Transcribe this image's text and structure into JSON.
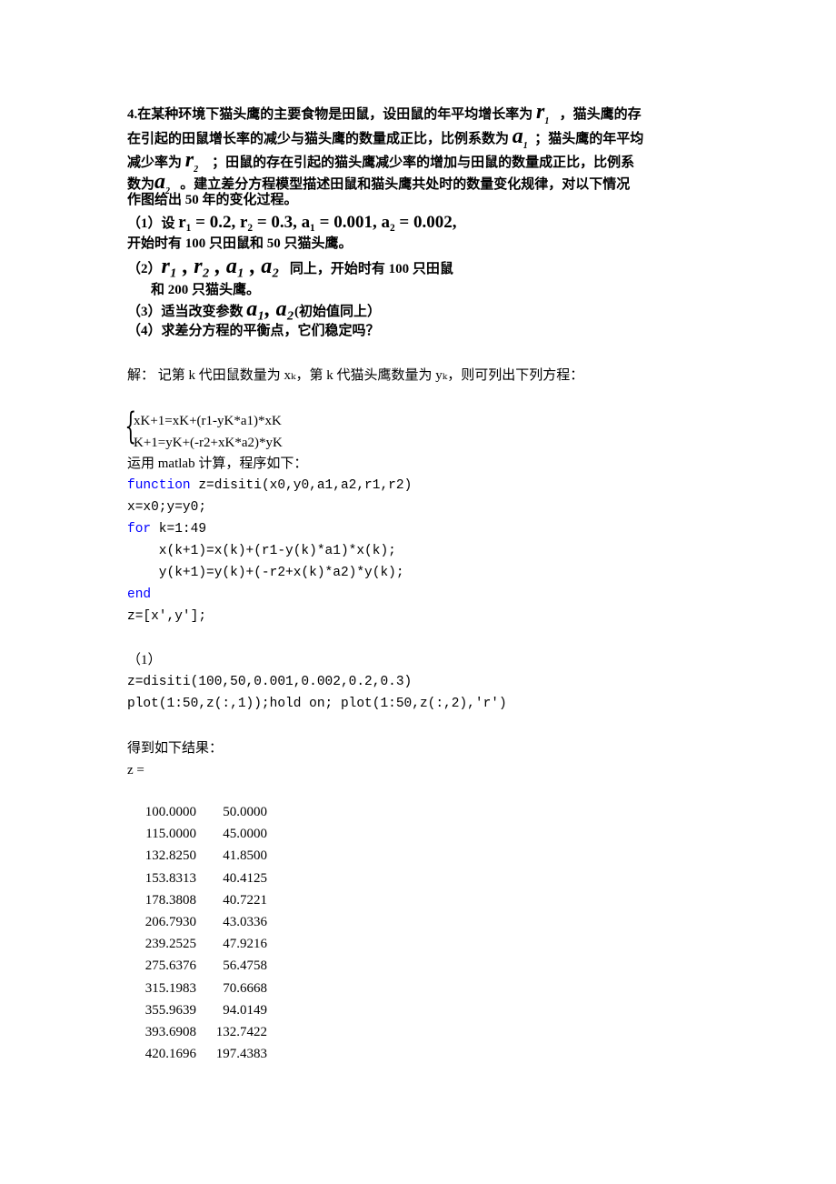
{
  "problem": {
    "line1_a": "4.在某种环境下猫头鹰的主要食物是田鼠，设田鼠的年平均增长率为",
    "line1_b": "，猫头鹰的存",
    "line2_a": "在引起的田鼠增长率的减少与猫头鹰的数量成正比，比例系数为",
    "line2_b": "；猫头鹰的年平均",
    "line3_a": "减少率为",
    "line3_b": "；田鼠的存在引起的猫头鹰减少率的增加与田鼠的数量成正比，比例系",
    "line4_a": "数为",
    "line4_b": "。建立差分方程模型描述田鼠和猫头鹰共处时的数量变化规律，对以下情况",
    "line5": "作图给出 50 年的变化过程。",
    "q1_a": "（1）设",
    "q1_math": "r₁ = 0.2, r₂ = 0.3, a₁ = 0.001, a₂ = 0.002,",
    "q1_b": "开始时有 100 只田鼠和 50 只猫头鹰。",
    "q2_a": "（2）",
    "q2_math": "r₁ , r₂ , a₁ , a₂",
    "q2_b": "同上，开始时有 100 只田鼠",
    "q2_c": "和 200 只猫头鹰。",
    "q3_a": "（3）适当改变参数",
    "q3_math": "a₁, a₂",
    "q3_b": "(初始值同上）",
    "q4": "（4）求差分方程的平衡点，它们稳定吗？"
  },
  "solution": {
    "intro": "解：     记第 k 代田鼠数量为 xₖ，第 k 代猫头鹰数量为 yₖ，则可列出下列方程：",
    "eq1": "xK+1=xK+(r1-yK*a1)*xK",
    "eq2": "K+1=yK+(-r2+xK*a2)*yK",
    "matlab_intro": "运用 matlab 计算，程序如下："
  },
  "code": [
    {
      "kw": "function",
      "text": " z=disiti(x0,y0,a1,a2,r1,r2)"
    },
    {
      "kw": "",
      "text": "x=x0;y=y0;"
    },
    {
      "kw": "for",
      "text": " k=1:49"
    },
    {
      "kw": "",
      "text": "    x(k+1)=x(k)+(r1-y(k)*a1)*x(k);"
    },
    {
      "kw": "",
      "text": "    y(k+1)=y(k)+(-r2+x(k)*a2)*y(k);"
    },
    {
      "kw": "end",
      "text": ""
    },
    {
      "kw": "",
      "text": "z=[x',y'];"
    }
  ],
  "part1": {
    "label": "（1）",
    "call": "z=disiti(100,50,0.001,0.002,0.2,0.3)",
    "plot": "plot(1:50,z(:,1));hold on; plot(1:50,z(:,2),'r')"
  },
  "result": {
    "label": "得到如下结果：",
    "z": "z ="
  },
  "table": [
    [
      "100.0000",
      "50.0000"
    ],
    [
      "115.0000",
      "45.0000"
    ],
    [
      "132.8250",
      "41.8500"
    ],
    [
      "153.8313",
      "40.4125"
    ],
    [
      "178.3808",
      "40.7221"
    ],
    [
      "206.7930",
      "43.0336"
    ],
    [
      "239.2525",
      "47.9216"
    ],
    [
      "275.6376",
      "56.4758"
    ],
    [
      "315.1983",
      "70.6668"
    ],
    [
      "355.9639",
      "94.0149"
    ],
    [
      "393.6908",
      "132.7422"
    ],
    [
      "420.1696",
      "197.4383"
    ]
  ],
  "colors": {
    "keyword": "#0000ff",
    "text": "#000000"
  }
}
